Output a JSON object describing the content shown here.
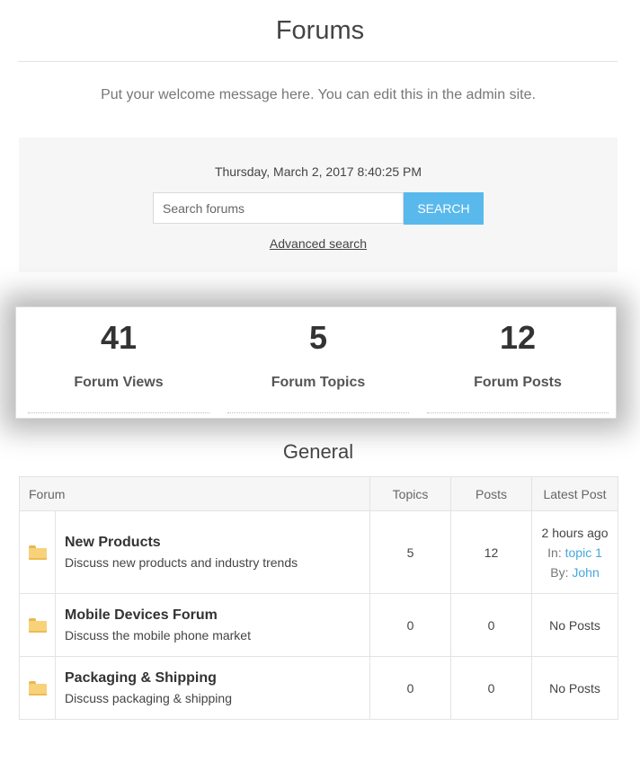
{
  "page": {
    "title": "Forums",
    "welcome": "Put your welcome message here. You can edit this in the admin site."
  },
  "search": {
    "datetime": "Thursday, March 2, 2017 8:40:25 PM",
    "placeholder": "Search forums",
    "button_label": "SEARCH",
    "advanced_label": "Advanced search"
  },
  "stats": {
    "views": {
      "value": "41",
      "label": "Forum Views"
    },
    "topics": {
      "value": "5",
      "label": "Forum Topics"
    },
    "posts": {
      "value": "12",
      "label": "Forum Posts"
    }
  },
  "section": {
    "title": "General",
    "columns": {
      "forum": "Forum",
      "topics": "Topics",
      "posts": "Posts",
      "latest": "Latest Post"
    },
    "rows": [
      {
        "icon": "folder-icon",
        "name": "New Products",
        "description": "Discuss new products and industry trends",
        "topics": "5",
        "posts": "12",
        "latest": {
          "time": "2 hours ago",
          "in_label": "In:",
          "topic": "topic 1",
          "by_label": "By:",
          "author": "John"
        }
      },
      {
        "icon": "folder-icon",
        "name": "Mobile Devices Forum",
        "description": "Discuss the mobile phone market",
        "topics": "0",
        "posts": "0",
        "latest_text": "No Posts"
      },
      {
        "icon": "folder-icon",
        "name": "Packaging & Shipping",
        "description": "Discuss packaging & shipping",
        "topics": "0",
        "posts": "0",
        "latest_text": "No Posts"
      }
    ]
  },
  "colors": {
    "accent": "#5ab9ec",
    "link": "#47a7dc",
    "panel_bg": "#f6f6f6"
  }
}
